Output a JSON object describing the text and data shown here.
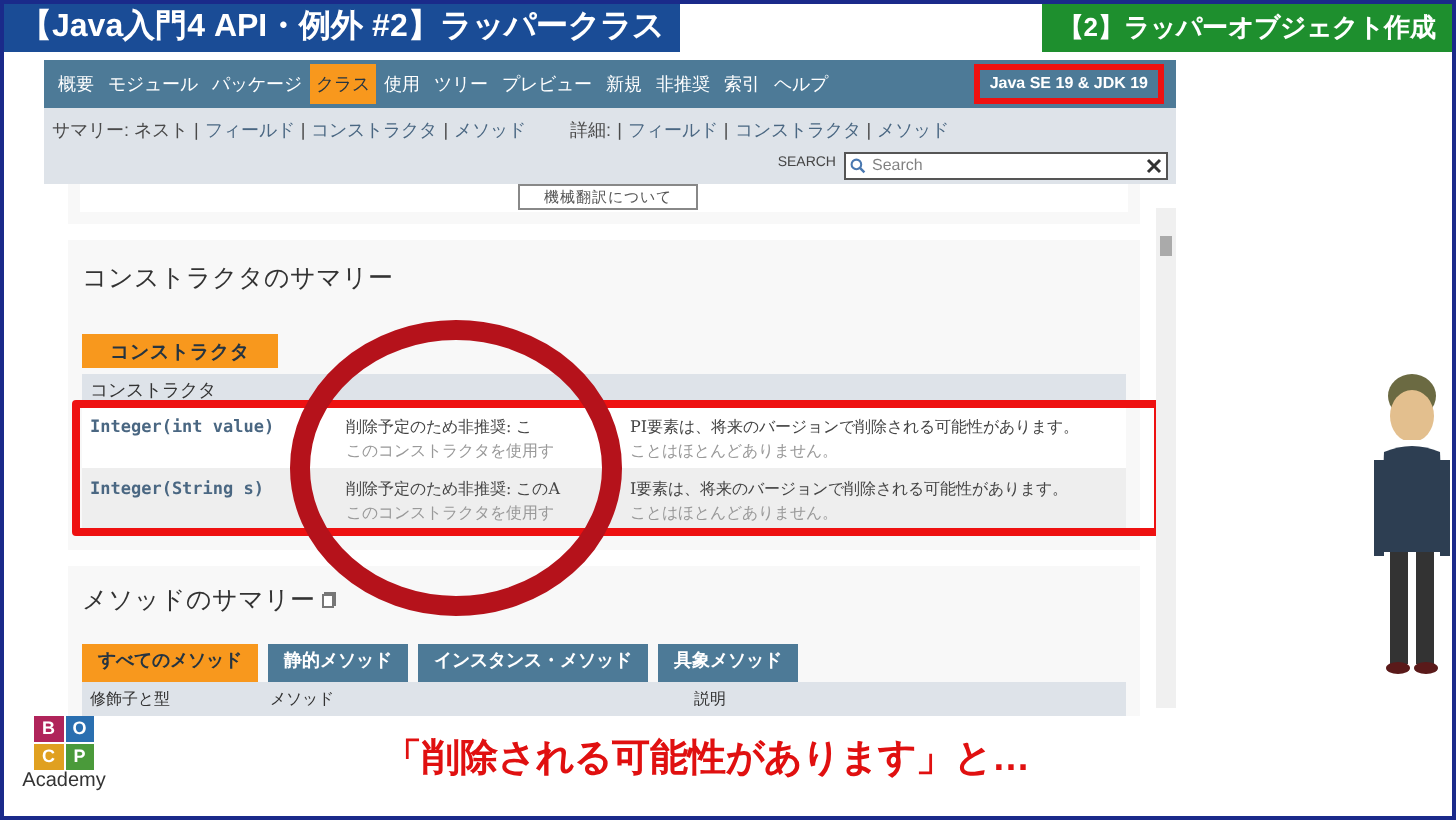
{
  "title_banner": "【Java入門4 API・例外 #2】ラッパークラス",
  "step_banner": "【2】ラッパーオブジェクト作成",
  "nav": {
    "items": [
      {
        "label": "概要",
        "selected": false
      },
      {
        "label": "モジュール",
        "selected": false
      },
      {
        "label": "パッケージ",
        "selected": false
      },
      {
        "label": "クラス",
        "selected": true
      },
      {
        "label": "使用",
        "selected": false
      },
      {
        "label": "ツリー",
        "selected": false
      },
      {
        "label": "プレビュー",
        "selected": false
      },
      {
        "label": "新規",
        "selected": false
      },
      {
        "label": "非推奨",
        "selected": false
      },
      {
        "label": "索引",
        "selected": false
      },
      {
        "label": "ヘルプ",
        "selected": false
      }
    ],
    "version": "Java SE 19 & JDK 19"
  },
  "subnav": {
    "separator": "|",
    "groups": [
      {
        "label": "サマリー: ネスト",
        "links": [
          "フィールド",
          "コンストラクタ",
          "メソッド"
        ]
      },
      {
        "label": "詳細:",
        "links": [
          "フィールド",
          "コンストラクタ",
          "メソッド"
        ]
      }
    ],
    "search_label": "SEARCH",
    "search_placeholder": "Search"
  },
  "translation_button": "機械翻訳について",
  "constructor_summary": {
    "heading": "コンストラクタのサマリー",
    "tab": "コンストラクタ",
    "column_1": "コンストラクタ",
    "rows": [
      {
        "name": "Integer(int value)",
        "line_1": [
          "削除予定のため非推奨: こ",
          "PI要素は、将来のバージョンで削除される可能性があります。"
        ],
        "line_2": [
          "このコンストラクタを使用す",
          "ことはほとんどありません。"
        ]
      },
      {
        "name": "Integer(String s)",
        "line_1": [
          "削除予定のため非推奨: このA",
          "I要素は、将来のバージョンで削除される可能性があります。"
        ],
        "line_2": [
          "このコンストラクタを使用す",
          "ことはほとんどありません。"
        ]
      }
    ]
  },
  "method_summary": {
    "heading": "メソッドのサマリー",
    "tabs": [
      {
        "label": "すべてのメソッド",
        "selected": true
      },
      {
        "label": "静的メソッド",
        "selected": false
      },
      {
        "label": "インスタンス・メソッド",
        "selected": false
      },
      {
        "label": "具象メソッド",
        "selected": false
      }
    ],
    "columns": [
      "修飾子と型",
      "メソッド",
      "説明"
    ]
  },
  "caption": "「削除される可能性があります」と…",
  "logo": {
    "letters": [
      {
        "text": "B",
        "color": "#b0245a"
      },
      {
        "text": "O",
        "color": "#2a6fb0"
      },
      {
        "text": "C",
        "color": "#e0a020"
      },
      {
        "text": "P",
        "color": "#4a9a3a"
      }
    ],
    "text": "Academy"
  }
}
